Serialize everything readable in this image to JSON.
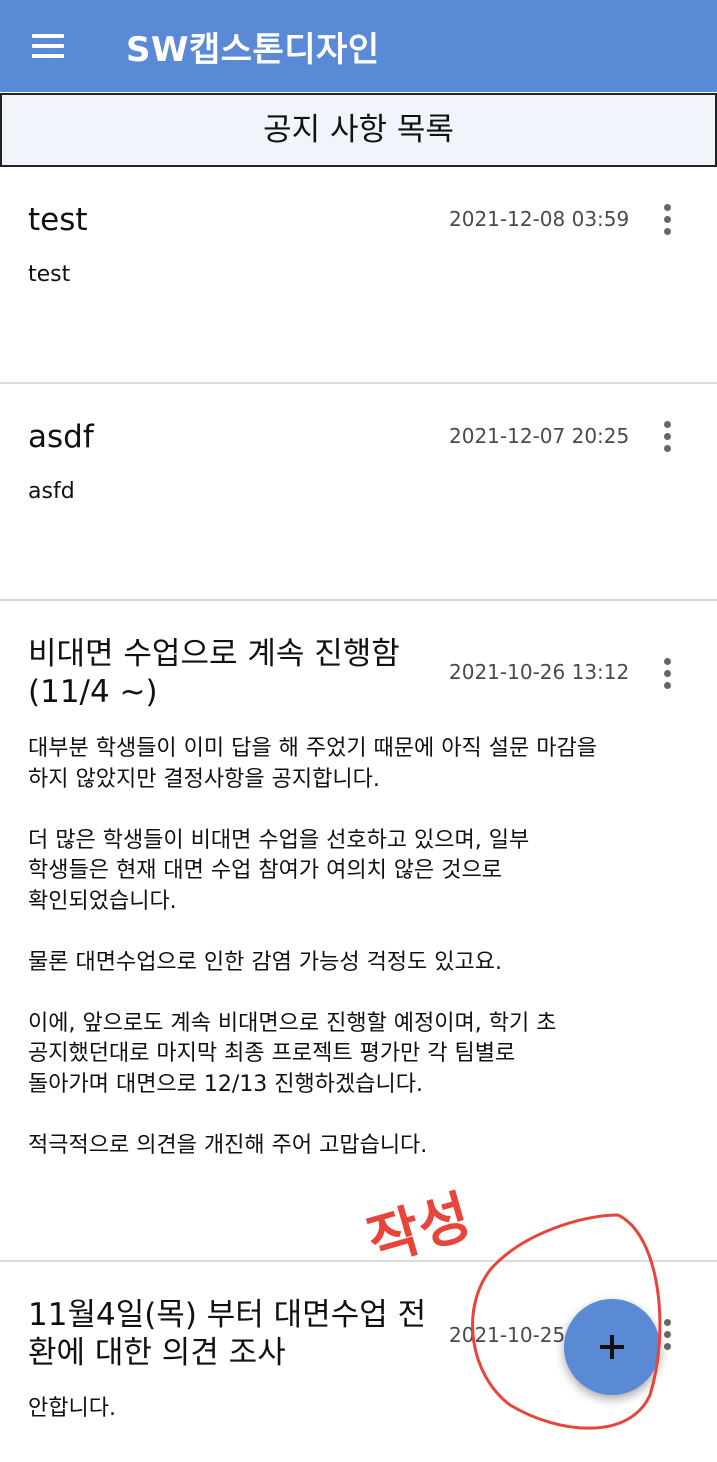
{
  "app": {
    "title": "SW캡스톤디자인"
  },
  "subheader": {
    "title": "공지 사항 목록"
  },
  "notices": [
    {
      "title": "test",
      "date": "2021-12-08 03:59",
      "body": "test"
    },
    {
      "title": "asdf",
      "date": "2021-12-07 20:25",
      "body": "asfd"
    },
    {
      "title": "비대면 수업으로 계속 진행함 (11/4 ~)",
      "date": "2021-10-26 13:12",
      "body": "대부분 학생들이 이미 답을 해 주었기 때문에 아직 설문 마감을\n하지 않았지만 결정사항을 공지합니다.\n\n더 많은 학생들이 비대면 수업을 선호하고 있으며, 일부\n학생들은 현재 대면 수업 참여가 여의치 않은 것으로\n확인되었습니다.\n\n물론 대면수업으로 인한 감염 가능성 걱정도 있고요.\n\n이에, 앞으로도 계속 비대면으로 진행할 예정이며, 학기 초\n공지했던대로 마지막 최종 프로젝트 평가만 각 팀별로\n돌아가며 대면으로 12/13 진행하겠습니다.\n\n적극적으로 의견을 개진해 주어 고맙습니다."
    },
    {
      "title": "11월4일(목) 부터 대면수업 전환에 대한 의견 조사",
      "date": "2021-10-25",
      "body": "안합니다."
    }
  ],
  "fab": {
    "icon": "plus-icon"
  },
  "annotation": {
    "text": "작성",
    "color": "#e8443a"
  },
  "colors": {
    "accent": "#5a8ad6"
  }
}
